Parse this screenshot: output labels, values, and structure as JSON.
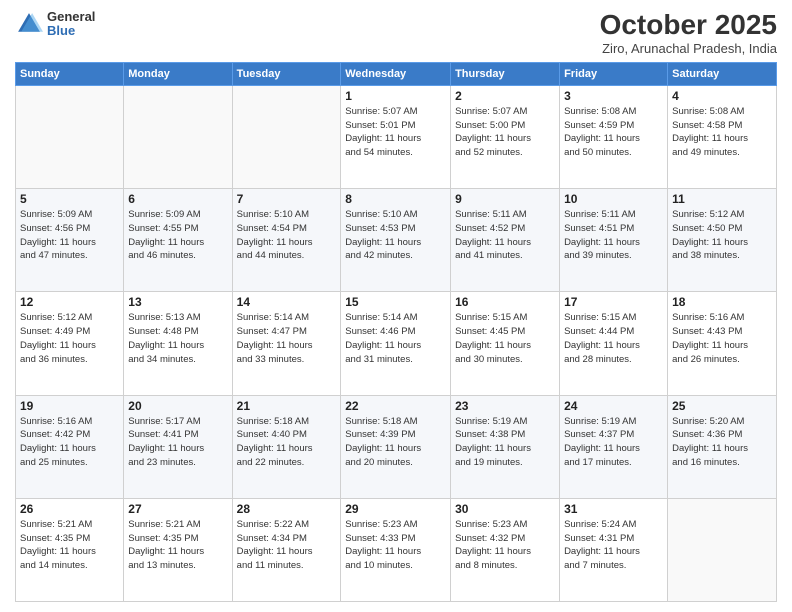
{
  "header": {
    "logo": {
      "general": "General",
      "blue": "Blue"
    },
    "title": "October 2025",
    "location": "Ziro, Arunachal Pradesh, India"
  },
  "days_of_week": [
    "Sunday",
    "Monday",
    "Tuesday",
    "Wednesday",
    "Thursday",
    "Friday",
    "Saturday"
  ],
  "weeks": [
    [
      {
        "day": "",
        "info": ""
      },
      {
        "day": "",
        "info": ""
      },
      {
        "day": "",
        "info": ""
      },
      {
        "day": "1",
        "info": "Sunrise: 5:07 AM\nSunset: 5:01 PM\nDaylight: 11 hours\nand 54 minutes."
      },
      {
        "day": "2",
        "info": "Sunrise: 5:07 AM\nSunset: 5:00 PM\nDaylight: 11 hours\nand 52 minutes."
      },
      {
        "day": "3",
        "info": "Sunrise: 5:08 AM\nSunset: 4:59 PM\nDaylight: 11 hours\nand 50 minutes."
      },
      {
        "day": "4",
        "info": "Sunrise: 5:08 AM\nSunset: 4:58 PM\nDaylight: 11 hours\nand 49 minutes."
      }
    ],
    [
      {
        "day": "5",
        "info": "Sunrise: 5:09 AM\nSunset: 4:56 PM\nDaylight: 11 hours\nand 47 minutes."
      },
      {
        "day": "6",
        "info": "Sunrise: 5:09 AM\nSunset: 4:55 PM\nDaylight: 11 hours\nand 46 minutes."
      },
      {
        "day": "7",
        "info": "Sunrise: 5:10 AM\nSunset: 4:54 PM\nDaylight: 11 hours\nand 44 minutes."
      },
      {
        "day": "8",
        "info": "Sunrise: 5:10 AM\nSunset: 4:53 PM\nDaylight: 11 hours\nand 42 minutes."
      },
      {
        "day": "9",
        "info": "Sunrise: 5:11 AM\nSunset: 4:52 PM\nDaylight: 11 hours\nand 41 minutes."
      },
      {
        "day": "10",
        "info": "Sunrise: 5:11 AM\nSunset: 4:51 PM\nDaylight: 11 hours\nand 39 minutes."
      },
      {
        "day": "11",
        "info": "Sunrise: 5:12 AM\nSunset: 4:50 PM\nDaylight: 11 hours\nand 38 minutes."
      }
    ],
    [
      {
        "day": "12",
        "info": "Sunrise: 5:12 AM\nSunset: 4:49 PM\nDaylight: 11 hours\nand 36 minutes."
      },
      {
        "day": "13",
        "info": "Sunrise: 5:13 AM\nSunset: 4:48 PM\nDaylight: 11 hours\nand 34 minutes."
      },
      {
        "day": "14",
        "info": "Sunrise: 5:14 AM\nSunset: 4:47 PM\nDaylight: 11 hours\nand 33 minutes."
      },
      {
        "day": "15",
        "info": "Sunrise: 5:14 AM\nSunset: 4:46 PM\nDaylight: 11 hours\nand 31 minutes."
      },
      {
        "day": "16",
        "info": "Sunrise: 5:15 AM\nSunset: 4:45 PM\nDaylight: 11 hours\nand 30 minutes."
      },
      {
        "day": "17",
        "info": "Sunrise: 5:15 AM\nSunset: 4:44 PM\nDaylight: 11 hours\nand 28 minutes."
      },
      {
        "day": "18",
        "info": "Sunrise: 5:16 AM\nSunset: 4:43 PM\nDaylight: 11 hours\nand 26 minutes."
      }
    ],
    [
      {
        "day": "19",
        "info": "Sunrise: 5:16 AM\nSunset: 4:42 PM\nDaylight: 11 hours\nand 25 minutes."
      },
      {
        "day": "20",
        "info": "Sunrise: 5:17 AM\nSunset: 4:41 PM\nDaylight: 11 hours\nand 23 minutes."
      },
      {
        "day": "21",
        "info": "Sunrise: 5:18 AM\nSunset: 4:40 PM\nDaylight: 11 hours\nand 22 minutes."
      },
      {
        "day": "22",
        "info": "Sunrise: 5:18 AM\nSunset: 4:39 PM\nDaylight: 11 hours\nand 20 minutes."
      },
      {
        "day": "23",
        "info": "Sunrise: 5:19 AM\nSunset: 4:38 PM\nDaylight: 11 hours\nand 19 minutes."
      },
      {
        "day": "24",
        "info": "Sunrise: 5:19 AM\nSunset: 4:37 PM\nDaylight: 11 hours\nand 17 minutes."
      },
      {
        "day": "25",
        "info": "Sunrise: 5:20 AM\nSunset: 4:36 PM\nDaylight: 11 hours\nand 16 minutes."
      }
    ],
    [
      {
        "day": "26",
        "info": "Sunrise: 5:21 AM\nSunset: 4:35 PM\nDaylight: 11 hours\nand 14 minutes."
      },
      {
        "day": "27",
        "info": "Sunrise: 5:21 AM\nSunset: 4:35 PM\nDaylight: 11 hours\nand 13 minutes."
      },
      {
        "day": "28",
        "info": "Sunrise: 5:22 AM\nSunset: 4:34 PM\nDaylight: 11 hours\nand 11 minutes."
      },
      {
        "day": "29",
        "info": "Sunrise: 5:23 AM\nSunset: 4:33 PM\nDaylight: 11 hours\nand 10 minutes."
      },
      {
        "day": "30",
        "info": "Sunrise: 5:23 AM\nSunset: 4:32 PM\nDaylight: 11 hours\nand 8 minutes."
      },
      {
        "day": "31",
        "info": "Sunrise: 5:24 AM\nSunset: 4:31 PM\nDaylight: 11 hours\nand 7 minutes."
      },
      {
        "day": "",
        "info": ""
      }
    ]
  ]
}
